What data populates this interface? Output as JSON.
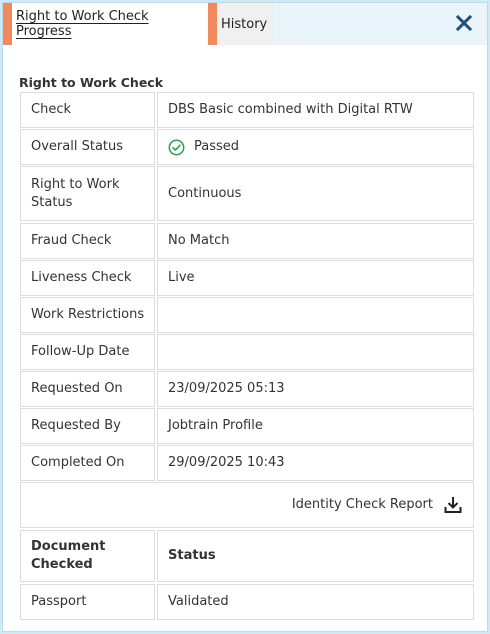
{
  "tabs": [
    {
      "label": "Right to Work Check Progress",
      "active": true
    },
    {
      "label": "History",
      "active": false
    }
  ],
  "section_title": "Right to Work Check",
  "details": [
    {
      "key": "Check",
      "value": "DBS Basic combined with Digital RTW"
    },
    {
      "key": "Overall Status",
      "value": "Passed",
      "icon": "check-circle-icon"
    },
    {
      "key": "Right to Work Status",
      "value": "Continuous"
    },
    {
      "key": "Fraud Check",
      "value": "No Match"
    },
    {
      "key": "Liveness Check",
      "value": "Live"
    },
    {
      "key": "Work Restrictions",
      "value": ""
    },
    {
      "key": "Follow-Up Date",
      "value": ""
    },
    {
      "key": "Requested On",
      "value": "23/09/2025 05:13"
    },
    {
      "key": "Requested By",
      "value": "Jobtrain Profile"
    },
    {
      "key": "Completed On",
      "value": "29/09/2025 10:43"
    }
  ],
  "report_link": {
    "label": "Identity Check Report",
    "icon": "download-icon"
  },
  "documents": {
    "headers": {
      "document": "Document Checked",
      "status": "Status"
    },
    "rows": [
      {
        "document": "Passport",
        "status": "Validated"
      }
    ]
  },
  "colors": {
    "accent": "#f08a5d",
    "close": "#1f4e79",
    "success": "#2e9e4f",
    "background": "#cfeaf5"
  }
}
